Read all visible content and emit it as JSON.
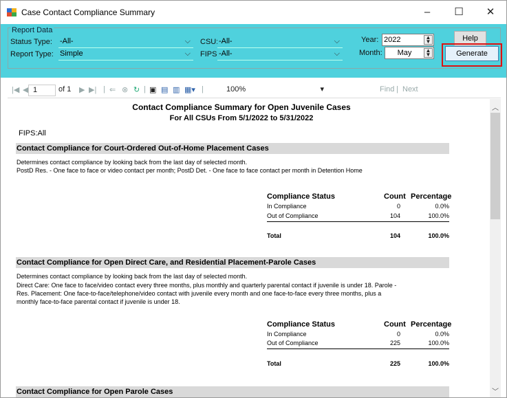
{
  "window": {
    "title": "Case Contact Compliance Summary",
    "minimize": "–",
    "maximize": "☐",
    "close": "✕"
  },
  "report_data": {
    "legend": "Report Data",
    "status_type_label": "Status Type:",
    "status_type_value": "-All-",
    "report_type_label": "Report Type:",
    "report_type_value": "Simple",
    "csu_label": "CSU:",
    "csu_value": "-All-",
    "fips_label": "FIPS:",
    "fips_value": "-All-",
    "year_label": "Year:",
    "year_value": "2022",
    "month_label": "Month:",
    "month_value": "May",
    "help_button": "Help",
    "generate_button": "Generate"
  },
  "toolbar": {
    "page_current": "1",
    "page_of": "of 1",
    "zoom": "100%",
    "find": "Find",
    "separator": "|",
    "next": "Next"
  },
  "report": {
    "title": "Contact Compliance Summary for Open Juvenile Cases",
    "subtitle": "For All CSUs From 5/1/2022 to 5/31/2022",
    "fips": "FIPS:All",
    "sections": [
      {
        "heading": "Contact Compliance for Court-Ordered Out-of-Home Placement Cases",
        "line1": "Determines contact compliance by looking back from the last day of selected month.",
        "line2": "PostD Res. - One face to face or video contact  per month; PostD Det. - One face to face contact per month in Detention Home",
        "table": {
          "h_status": "Compliance Status",
          "h_count": "Count",
          "h_pct": "Percentage",
          "rows": [
            {
              "status": "In Compliance",
              "count": "0",
              "pct": "0.0%"
            },
            {
              "status": "Out of Compliance",
              "count": "104",
              "pct": "100.0%"
            }
          ],
          "total_label": "Total",
          "total_count": "104",
          "total_pct": "100.0%"
        }
      },
      {
        "heading": "Contact Compliance for Open Direct Care, and Residential Placement-Parole Cases",
        "line1": "Determines contact compliance by looking back from the last day of selected month.",
        "line2": "Direct Care: One face to face/video contact every three months, plus monthly and quarterly parental contact if juvenile is under 18. Parole -",
        "line3": "Res. Placement: One face-to-face/telephone/video contact with juvenile every month and one face-to-face every three months, plus a",
        "line4": "monthly face-to-face parental contact if juvenile is under 18.",
        "table": {
          "h_status": "Compliance Status",
          "h_count": "Count",
          "h_pct": "Percentage",
          "rows": [
            {
              "status": "In Compliance",
              "count": "0",
              "pct": "0.0%"
            },
            {
              "status": "Out of Compliance",
              "count": "225",
              "pct": "100.0%"
            }
          ],
          "total_label": "Total",
          "total_count": "225",
          "total_pct": "100.0%"
        }
      },
      {
        "heading": "Contact Compliance for Open Parole Cases"
      }
    ]
  }
}
